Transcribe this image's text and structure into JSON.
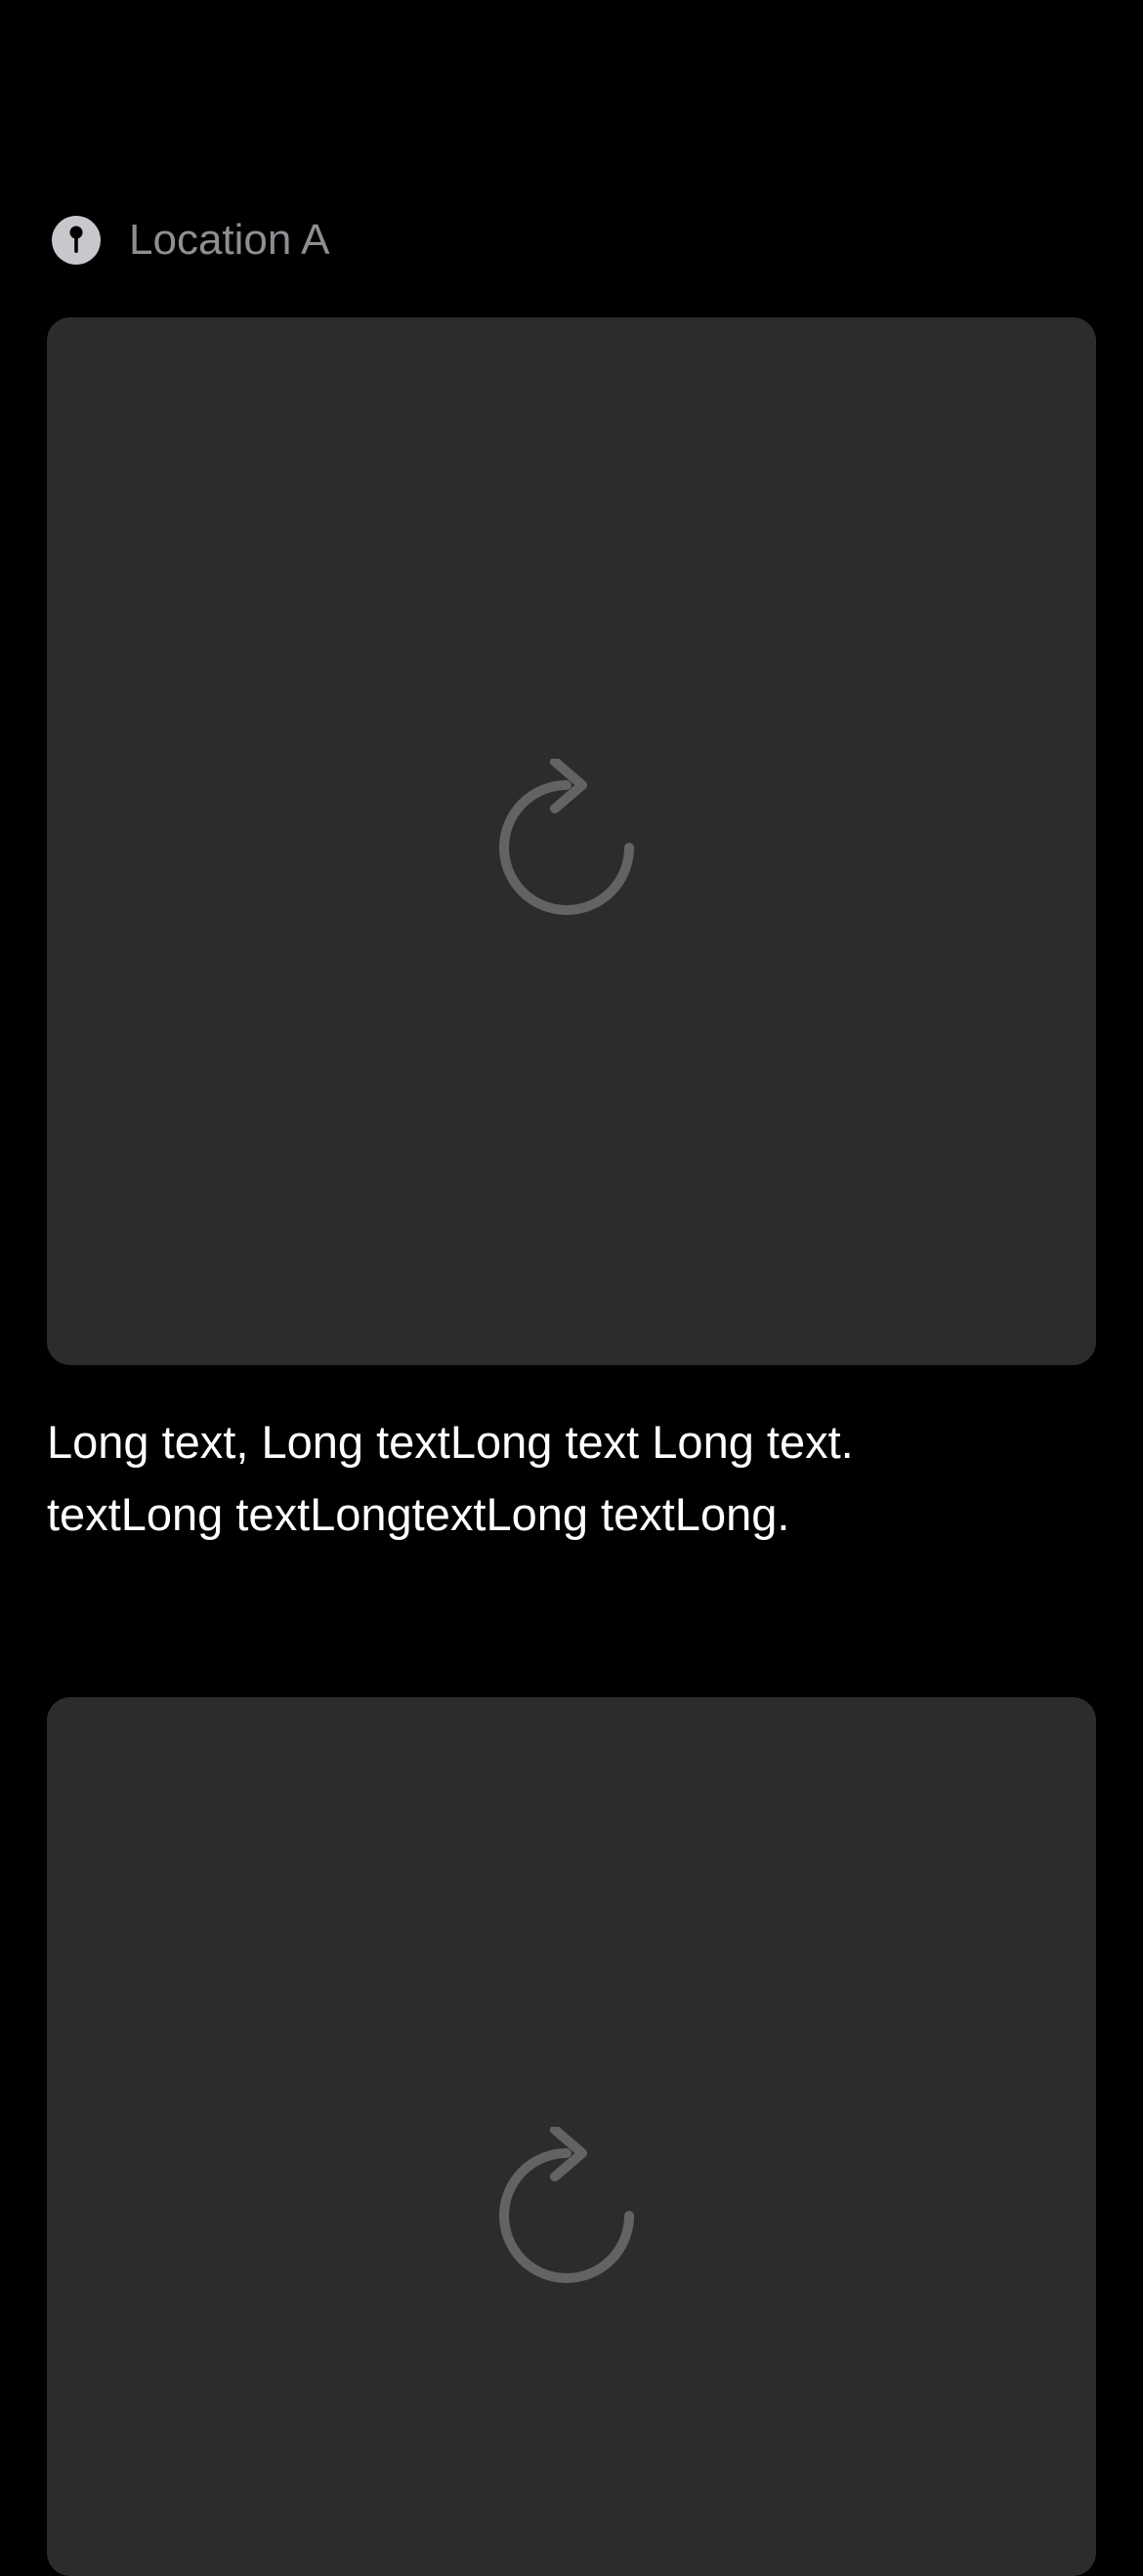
{
  "post": {
    "location": {
      "label": "Location A",
      "icon": "pin-icon"
    },
    "caption": "Long text, Long textLong text Long text.\ntextLong textLongtextLong textLong.",
    "media": [
      {
        "state": "reload",
        "icon": "reload-icon"
      },
      {
        "state": "reload",
        "icon": "reload-icon"
      }
    ]
  },
  "colors": {
    "background": "#000000",
    "card": "#2c2c2e",
    "secondary_text": "#8e8e93",
    "icon": "#636366",
    "primary_text": "#ffffff"
  }
}
